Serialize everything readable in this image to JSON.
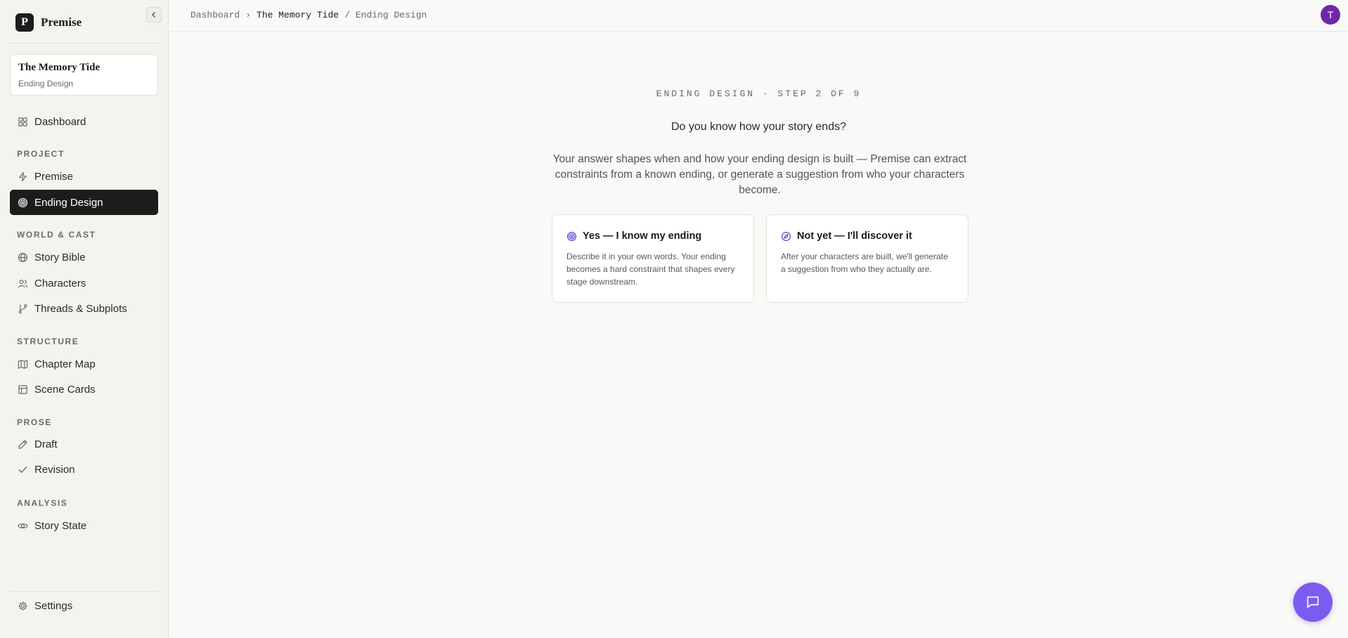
{
  "brand": {
    "logo_letter": "P",
    "name": "Premise"
  },
  "project": {
    "title": "The Memory Tide",
    "subtitle": "Ending Design"
  },
  "nav": {
    "dashboard": "Dashboard",
    "sections": {
      "project": "PROJECT",
      "world_cast": "WORLD & CAST",
      "structure": "STRUCTURE",
      "prose": "PROSE",
      "analysis": "ANALYSIS"
    },
    "items": {
      "premise": "Premise",
      "ending_design": "Ending Design",
      "story_bible": "Story Bible",
      "characters": "Characters",
      "threads": "Threads & Subplots",
      "chapter_map": "Chapter Map",
      "scene_cards": "Scene Cards",
      "draft": "Draft",
      "revision": "Revision",
      "story_state": "Story State"
    },
    "settings": "Settings",
    "active": "ending_design"
  },
  "breadcrumb": {
    "root": "Dashboard",
    "sep1": "›",
    "project": "The Memory Tide",
    "sep2": "/",
    "page": "Ending Design"
  },
  "user": {
    "avatar_letter": "T",
    "avatar_color": "#6d28a8"
  },
  "main": {
    "step_label": "ENDING DESIGN · STEP 2 OF 9",
    "question": "Do you know how your story ends?",
    "explanation": "Your answer shapes when and how your ending design is built — Premise can extract constraints from a known ending, or generate a suggestion from who your characters become.",
    "choices": [
      {
        "icon": "target-icon",
        "title": "Yes — I know my ending",
        "body": "Describe it in your own words. Your ending becomes a hard constraint that shapes every stage downstream."
      },
      {
        "icon": "compass-icon",
        "title": "Not yet — I'll discover it",
        "body": "After your characters are built, we'll generate a suggestion from who they actually are."
      }
    ]
  },
  "colors": {
    "accent": "#7c5cf0",
    "active_nav": "#1c1c1a",
    "icon_accent": "#5b3fd0"
  },
  "chat_button": {
    "icon": "chat-icon"
  }
}
